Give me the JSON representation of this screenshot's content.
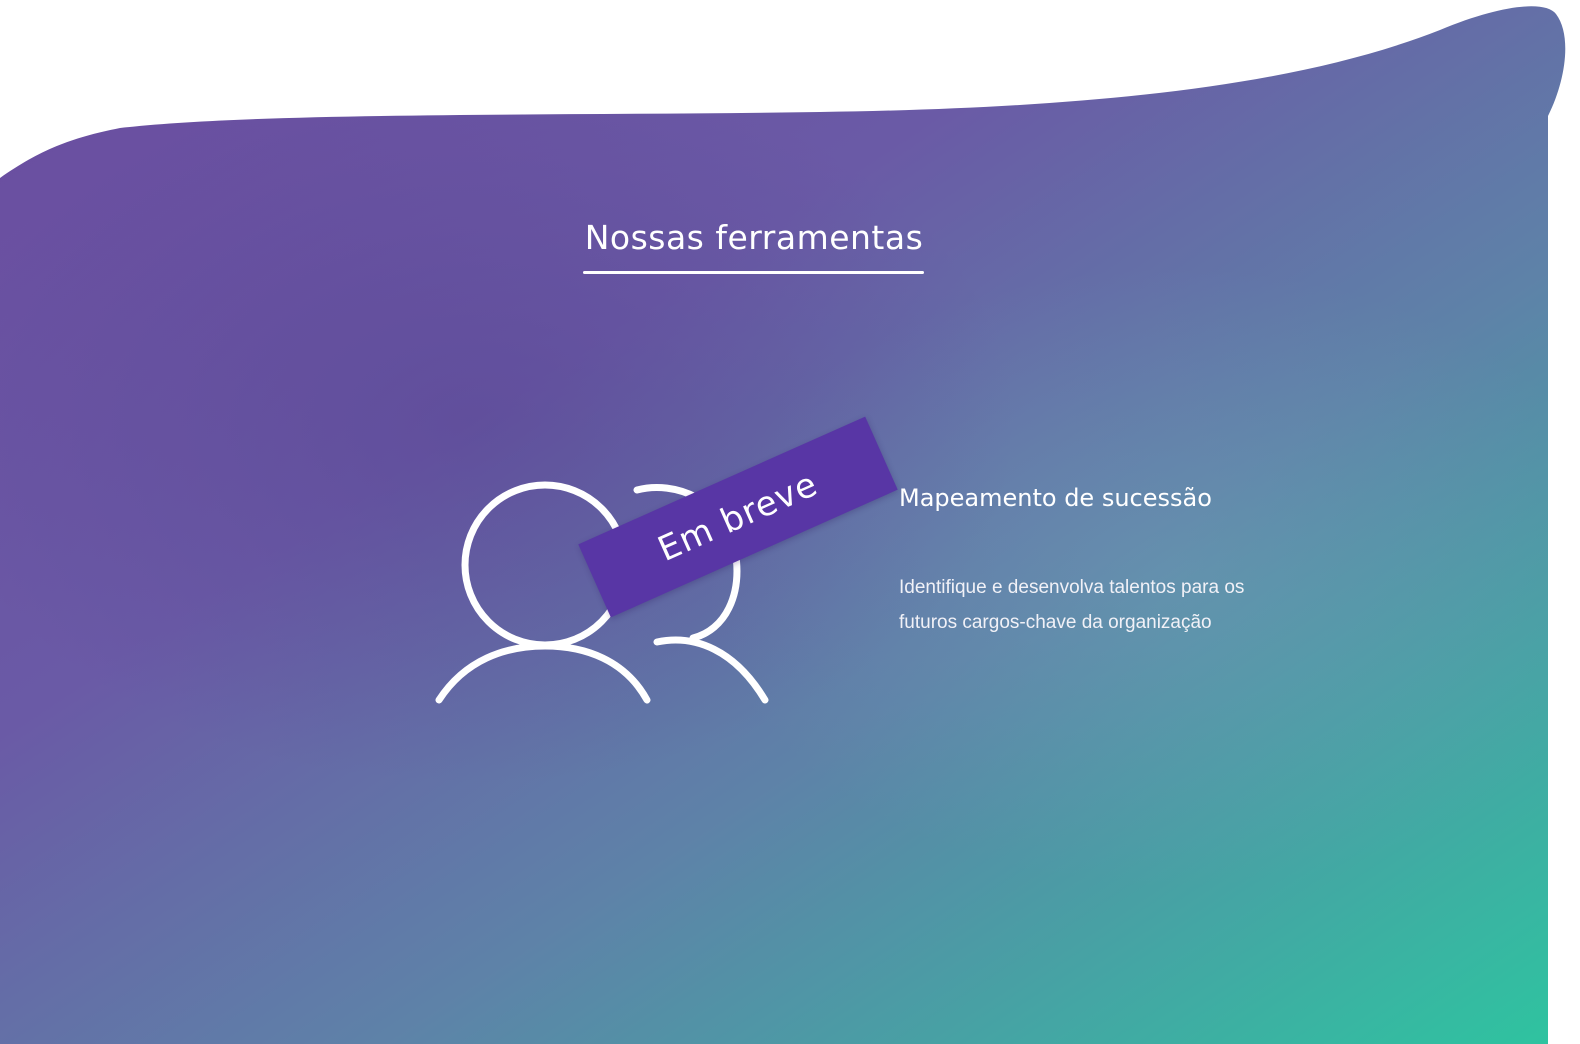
{
  "section": {
    "title": "Nossas ferramentas"
  },
  "tool": {
    "icon": "users-icon",
    "badge": "Em breve",
    "title": "Mapeamento de sucessão",
    "description": "Identifique e desenvolva talentos para os futuros cargos-chave da organização"
  },
  "colors": {
    "gradient_start": "#6a4c9f",
    "gradient_mid": "#5f7ca8",
    "gradient_end": "#2ec4a0",
    "badge_background": "#5836a5",
    "text": "#ffffff"
  }
}
